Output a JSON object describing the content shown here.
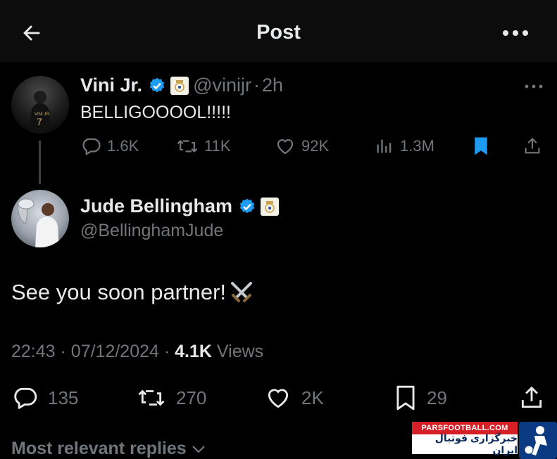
{
  "header": {
    "title": "Post"
  },
  "quoted_tweet": {
    "display_name": "Vini Jr.",
    "handle": "@vinijr",
    "separator": "·",
    "time": "2h",
    "text": "BELLIGOOOOL!!!!!",
    "actions": {
      "replies": "1.6K",
      "reposts": "11K",
      "likes": "92K",
      "views": "1.3M"
    }
  },
  "main_tweet": {
    "display_name": "Jude Bellingham",
    "handle": "@BellinghamJude",
    "text": "See you soon partner!",
    "emoji": "⚔️",
    "time": "22:43",
    "date_sep": "·",
    "date": "07/12/2024",
    "views_sep": "·",
    "views_count": "4.1K",
    "views_label": "Views",
    "actions": {
      "replies": "135",
      "reposts": "270",
      "likes": "2K",
      "bookmarks": "29"
    }
  },
  "replies_filter": {
    "label": "Most relevant replies"
  },
  "watermark": {
    "site": "PARSFOOTBALL.COM",
    "tagline": "خبرگزاری فوتبال ایران"
  },
  "colors": {
    "background": "#000000",
    "muted": "#71767b",
    "verified": "#1d9bf0",
    "bookmark_active": "#1d9bf0"
  },
  "icons": [
    "back-arrow-icon",
    "more-icon",
    "verified-icon",
    "club-crest-icon",
    "reply-icon",
    "repost-icon",
    "like-icon",
    "views-icon",
    "bookmark-icon",
    "share-icon",
    "chevron-down-icon",
    "swords-icon"
  ]
}
